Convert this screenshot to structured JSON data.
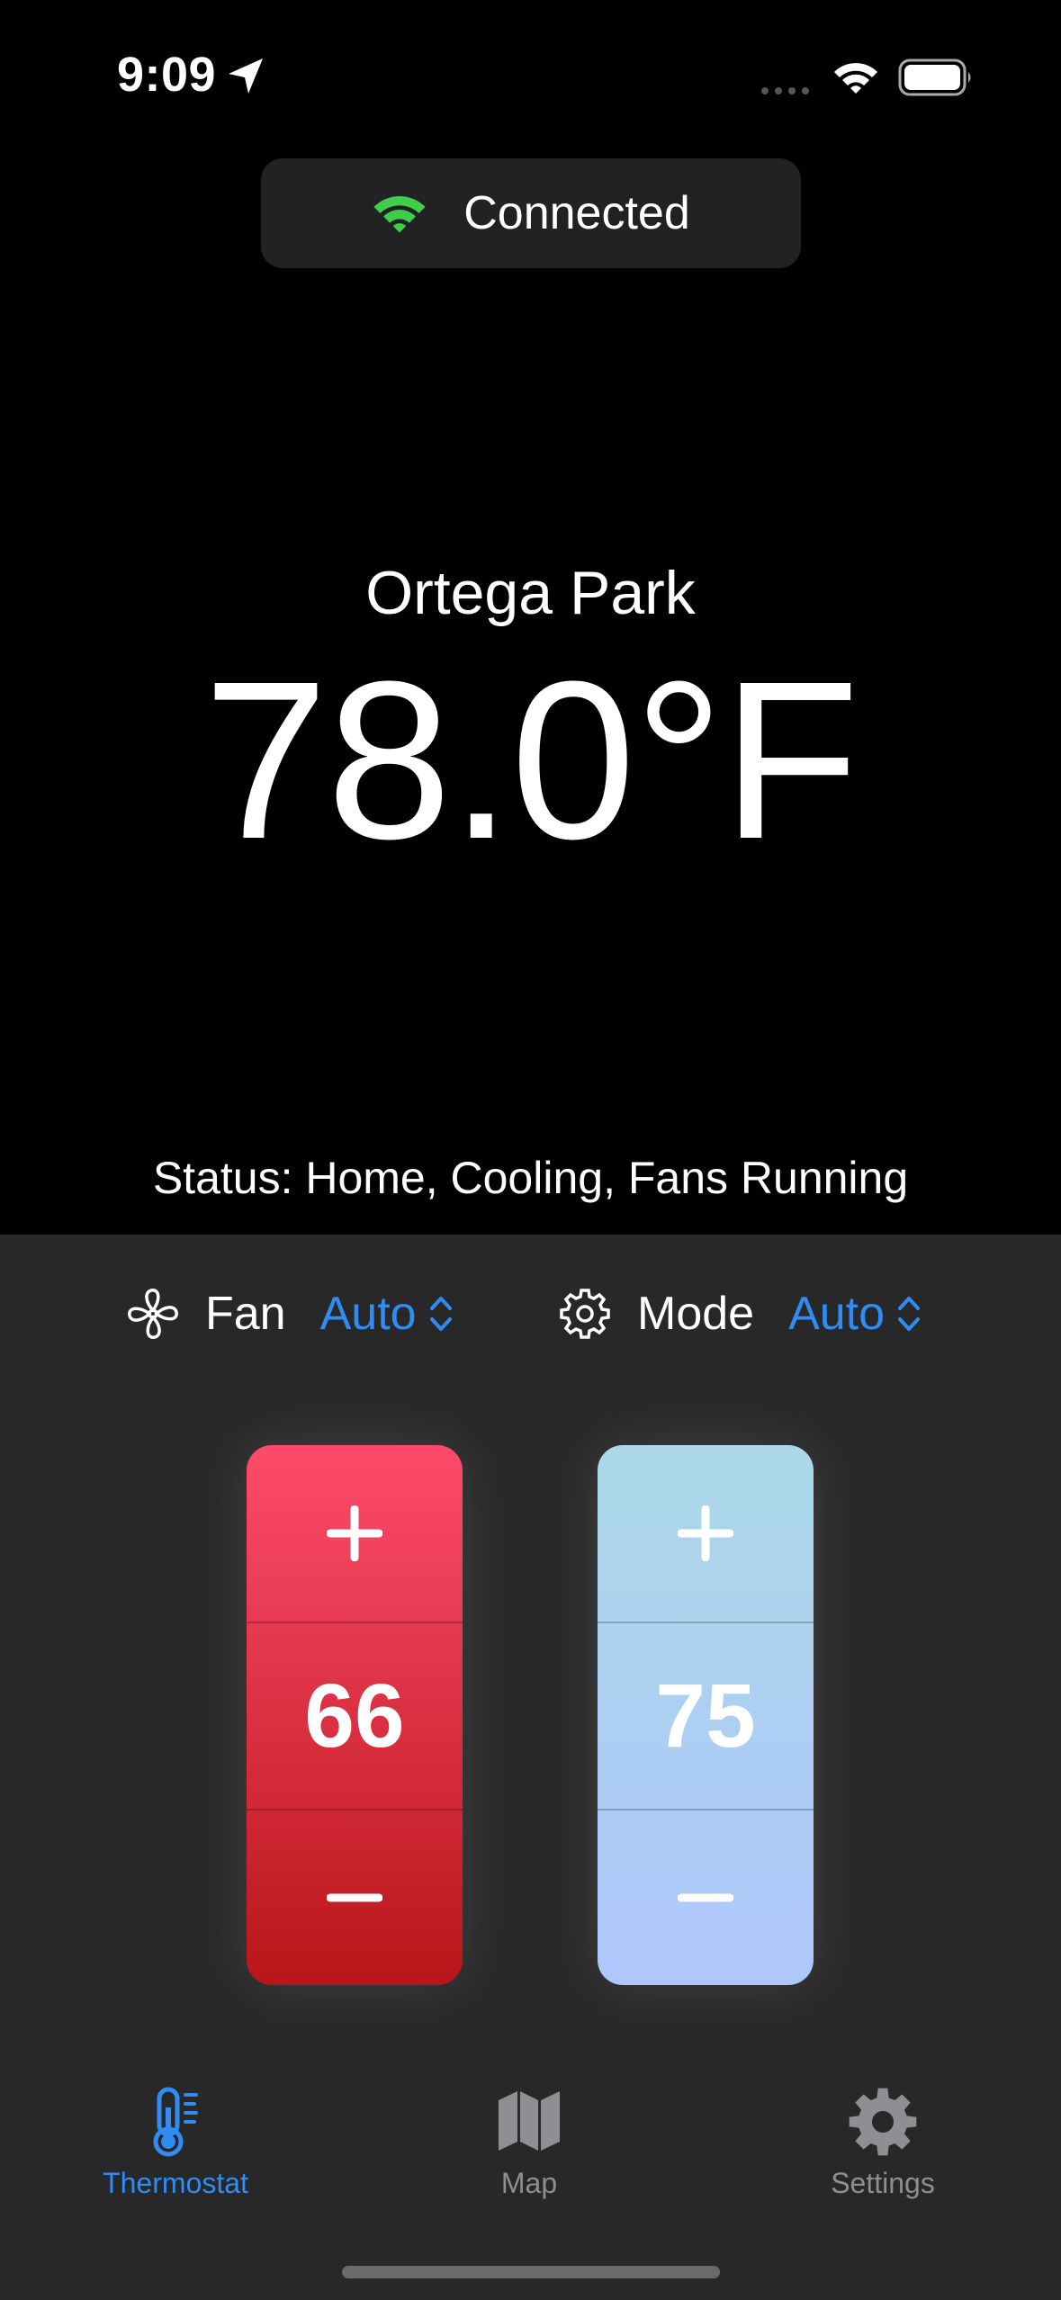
{
  "status_bar": {
    "time": "9:09"
  },
  "connection": {
    "label": "Connected",
    "icon": "wifi-icon",
    "color": "#3ecf4a"
  },
  "thermostat": {
    "location": "Ortega Park",
    "temperature": "78.0°F",
    "status": "Status: Home, Cooling, Fans Running"
  },
  "controls": {
    "fan": {
      "label": "Fan",
      "value": "Auto",
      "icon": "fan-icon"
    },
    "mode": {
      "label": "Mode",
      "value": "Auto",
      "icon": "gear-icon"
    }
  },
  "setpoints": {
    "heat": {
      "value": "66",
      "color_top": "#fe4b6b",
      "color_bottom": "#b8161a"
    },
    "cool": {
      "value": "75",
      "color_top": "#acd8e8",
      "color_bottom": "#aec7fc"
    }
  },
  "tab_bar": {
    "items": [
      {
        "label": "Thermostat",
        "icon": "thermometer-icon",
        "active": true
      },
      {
        "label": "Map",
        "icon": "map-icon",
        "active": false
      },
      {
        "label": "Settings",
        "icon": "gear-icon",
        "active": false
      }
    ]
  },
  "colors": {
    "accent": "#2f8cf4",
    "panel": "#282829",
    "inactive": "#8e8e93"
  }
}
